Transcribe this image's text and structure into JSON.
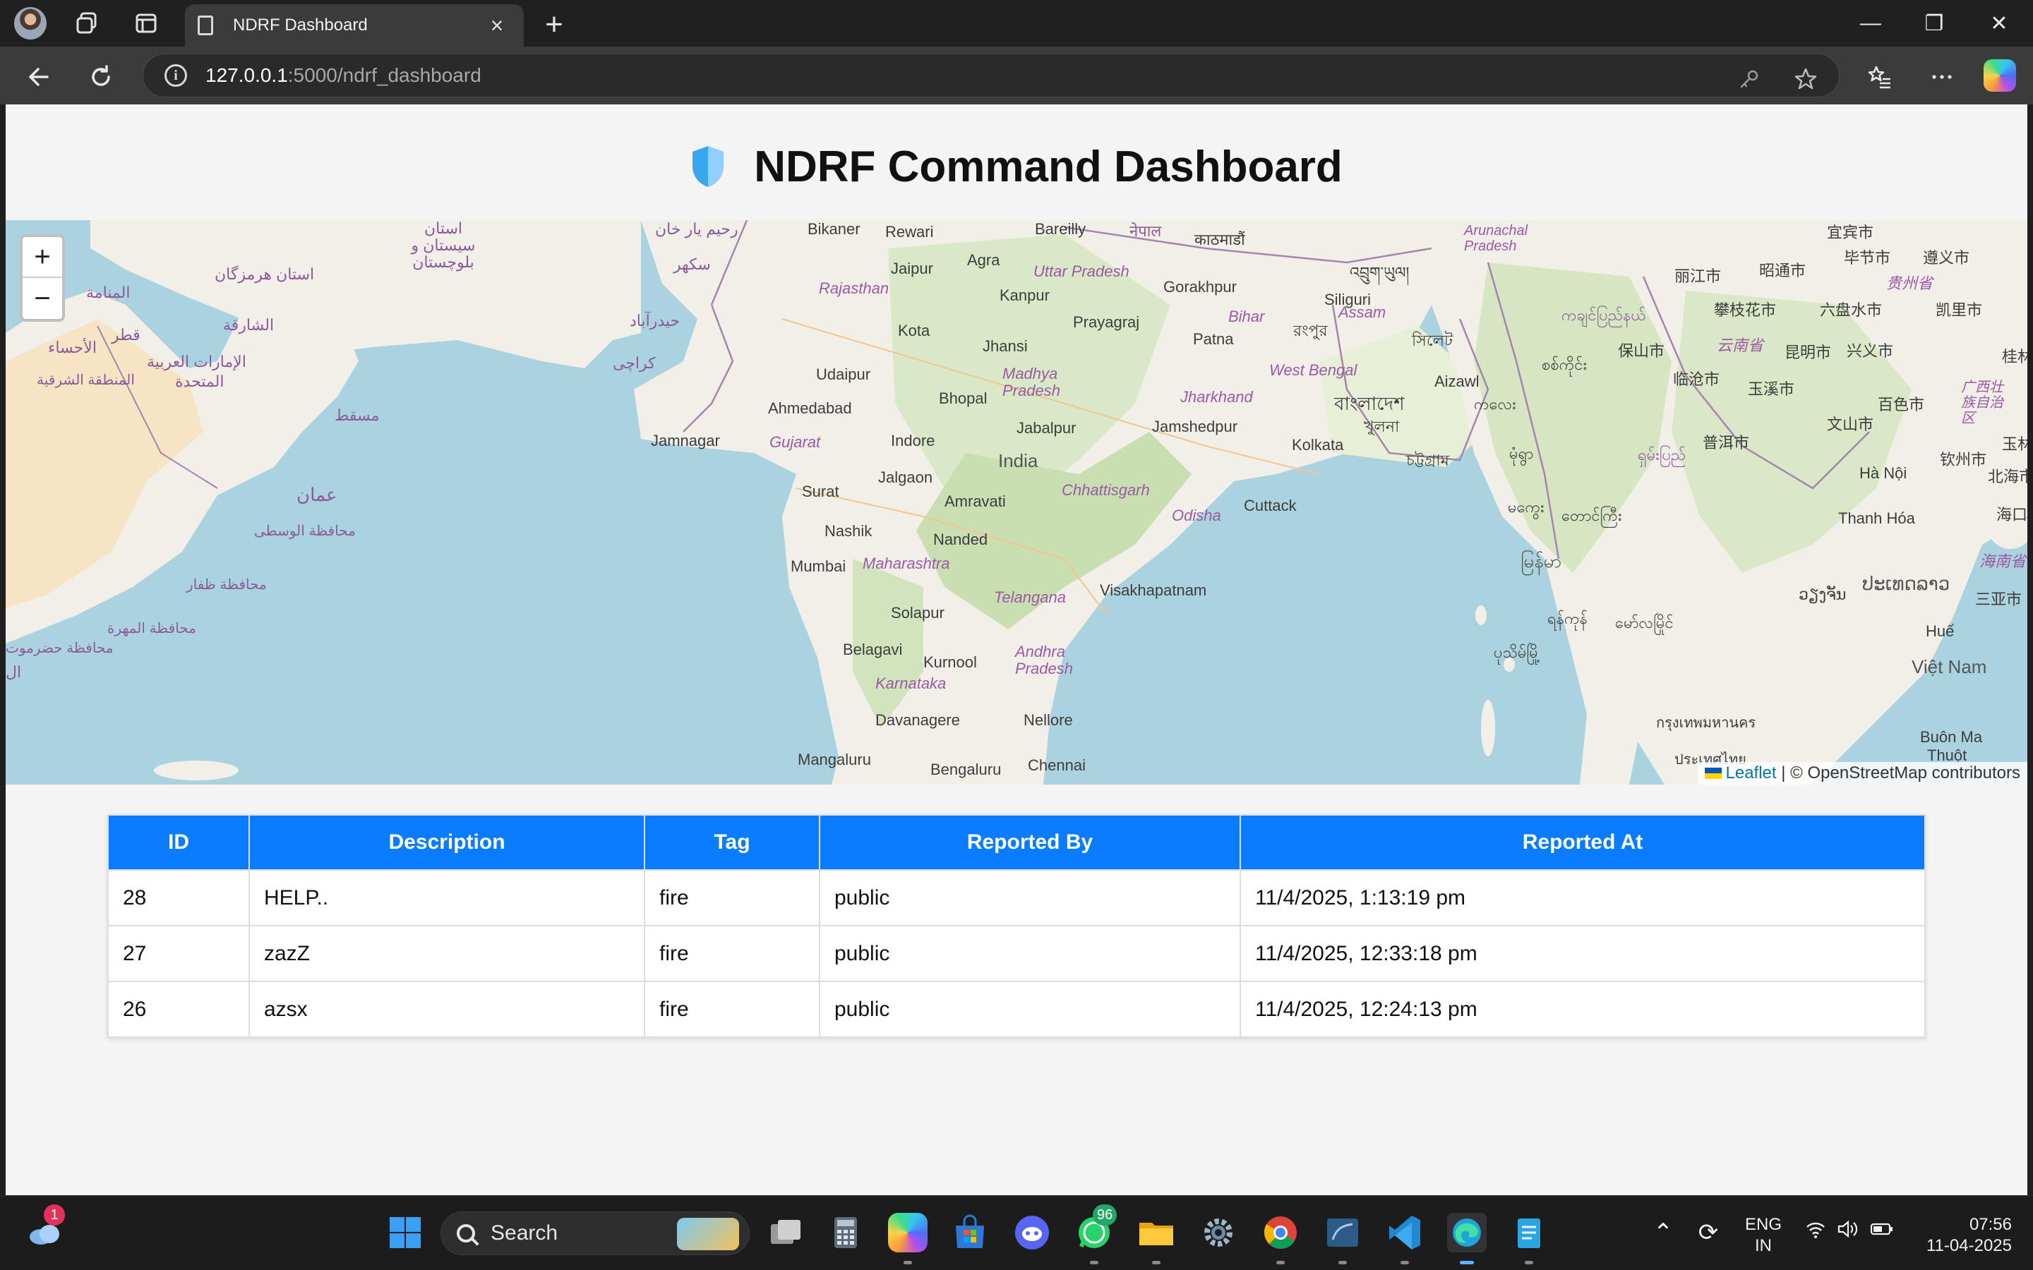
{
  "browser": {
    "tab_title": "NDRF Dashboard",
    "url_host": "127.0.0.1",
    "url_rest": ":5000/ndrf_dashboard",
    "new_tab": "+",
    "close_tab": "×",
    "window_controls": {
      "minimize": "—",
      "restore": "❐",
      "close": "✕"
    }
  },
  "page": {
    "title": "NDRF Command Dashboard"
  },
  "map": {
    "zoom_in": "+",
    "zoom_out": "−",
    "attribution_leaflet": "Leaflet",
    "attribution_rest": "| © OpenStreetMap contributors",
    "labels": {
      "bikaner": "Bikaner",
      "rewari": "Rewari",
      "bareilly": "Bareilly",
      "jaipur": "Jaipur",
      "agra": "Agra",
      "uttar_pradesh": "Uttar Pradesh",
      "gorakhpur": "Gorakhpur",
      "siliguri": "Siliguri",
      "kanpur": "Kanpur",
      "rajasthan": "Rajasthan",
      "prayagraj": "Prayagraj",
      "bihar": "Bihar",
      "assam": "Assam",
      "kota": "Kota",
      "jhansi": "Jhansi",
      "patna": "Patna",
      "udaipur": "Udaipur",
      "madhya_pradesh": "Madhya Pradesh",
      "west_bengal": "West Bengal",
      "aizawl": "Aizawl",
      "bhopal": "Bhopal",
      "jharkhand": "Jharkhand",
      "ahmedabad": "Ahmedabad",
      "jabalpur": "Jabalpur",
      "jamshedpur": "Jamshedpur",
      "jamnagar": "Jamnagar",
      "gujarat": "Gujarat",
      "indore": "Indore",
      "kolkata": "Kolkata",
      "india": "India",
      "jalgaon": "Jalgaon",
      "surat": "Surat",
      "chhattisgarh": "Chhattisgarh",
      "amravati": "Amravati",
      "cuttack": "Cuttack",
      "odisha": "Odisha",
      "nashik": "Nashik",
      "nanded": "Nanded",
      "mumbai": "Mumbai",
      "maharashtra": "Maharashtra",
      "telangana": "Telangana",
      "visakhapatnam": "Visakhapatnam",
      "solapur": "Solapur",
      "belagavi": "Belagavi",
      "kurnool": "Kurnool",
      "andhra_pradesh": "Andhra Pradesh",
      "karnataka": "Karnataka",
      "davanagere": "Davanagere",
      "nellore": "Nellore",
      "mangaluru": "Mangaluru",
      "bengaluru": "Bengaluru",
      "chennai": "Chennai",
      "arunachal_pradesh": "Arunachal Pradesh",
      "ha_noi": "Hà Nội",
      "thanh_hoa": "Thanh Hóa",
      "hue": "Huế",
      "viet_nam": "Việt Nam",
      "buon_ma": "Buôn Ma",
      "thuot": "Thuột",
      "cn_yichun": "宜宾市",
      "cn_bijie": "毕节市",
      "cn_zunyi": "遵义市",
      "cn_lijiang": "丽江市",
      "cn_zhaotong": "昭通市",
      "cn_guizhou": "贵州省",
      "cn_panzhihua": "攀枝花市",
      "cn_liupanshui": "六盘水市",
      "cn_kaili": "凯里市",
      "cn_baoshan": "保山市",
      "cn_yunnan": "云南省",
      "cn_kunming": "昆明市",
      "cn_xingyi": "兴义市",
      "cn_lincang": "临沧市",
      "cn_yuxi": "玉溪市",
      "cn_baise": "百色市",
      "cn_guangxi": "广西壮族自治区",
      "cn_wenshan": "文山市",
      "cn_puer": "普洱市",
      "cn_qinzhou": "钦州市",
      "cn_beihai": "北海市",
      "cn_haikou": "海口",
      "cn_hainan": "海南省",
      "cn_sanya": "三亚市",
      "cn_gui": "桂林",
      "cn_yu": "玉林",
      "ar_sistan": "استان سیستان و بلوچستان",
      "ar_rahim": "رحیم یار خان",
      "ar_sukkur": "سکھر",
      "ar_hyderabad": "حیدرآباد",
      "ar_karachi": "کراچی",
      "ar_hormozgan": "استان هرمزگان",
      "ar_manama": "المنامة",
      "ar_sharjah": "الشارقة",
      "ar_qatar": "قطر",
      "ar_ahsa": "الأحساء",
      "ar_uae1": "الإمارات العربية",
      "ar_uae2": "المتحدة",
      "ar_eastern": "المنطقة الشرقية",
      "ar_muscat": "مسقط",
      "ar_oman": "عمان",
      "ar_wusta": "محافظة الوسطى",
      "ar_dhofar": "محافظة ظفار",
      "ar_mahra": "محافظة المهرة",
      "ar_hadramaut": "محافظة حضرموت",
      "ne_nepal": "नेपाल",
      "ne_kathmandu": "काठमाडौं",
      "dz_bhutan": "འབྲུག་ཡུལ།",
      "bn_rangpur": "রংপুর",
      "bn_sylhet": "সিলেট",
      "bn_bangladesh": "বাংলাদেশ",
      "bn_khulna": "খুলনা",
      "bn_chattogram": "চট্টগ্রাম",
      "my_kachin": "ကချင်ပြည်နယ်",
      "my_sagaing": "စစ်ကိုင်း",
      "my_kalay": "ကလေး",
      "my_monywa": "မုံရွာ",
      "my_shan": "ရှမ်းပြည်",
      "my_magway": "မကွေး",
      "my_taunggyi": "တောင်ကြီး",
      "my_myanmar": "မြန်မာ",
      "my_yangon": "ရန်ကုန်",
      "my_pathein": "ပုသိမ်မြို့",
      "my_mawlamyine": "မော်လမြိုင်",
      "lo_vientiane": "ວຽງຈັນ",
      "lo_laos": "ປະເທດລາວ",
      "th_bangkok": "กรุงเทพมหานคร",
      "th_thai": "ประเทศไทย",
      "al_l": "ال"
    }
  },
  "table": {
    "headers": [
      "ID",
      "Description",
      "Tag",
      "Reported By",
      "Reported At"
    ],
    "rows": [
      [
        "28",
        "HELP..",
        "fire",
        "public",
        "11/4/2025, 1:13:19 pm"
      ],
      [
        "27",
        "zazZ",
        "fire",
        "public",
        "11/4/2025, 12:33:18 pm"
      ],
      [
        "26",
        "azsx",
        "fire",
        "public",
        "11/4/2025, 12:24:13 pm"
      ]
    ]
  },
  "taskbar": {
    "search_label": "Search",
    "weather_badge": "1",
    "whatsapp_badge": "96",
    "lang_line1": "ENG",
    "lang_line2": "IN",
    "time": "07:56",
    "date": "11-04-2025"
  },
  "colors": {
    "table_header": "#0a7cff",
    "page_bg": "#f4f4f4",
    "water": "#aad3df",
    "land": "#f2efe9"
  }
}
